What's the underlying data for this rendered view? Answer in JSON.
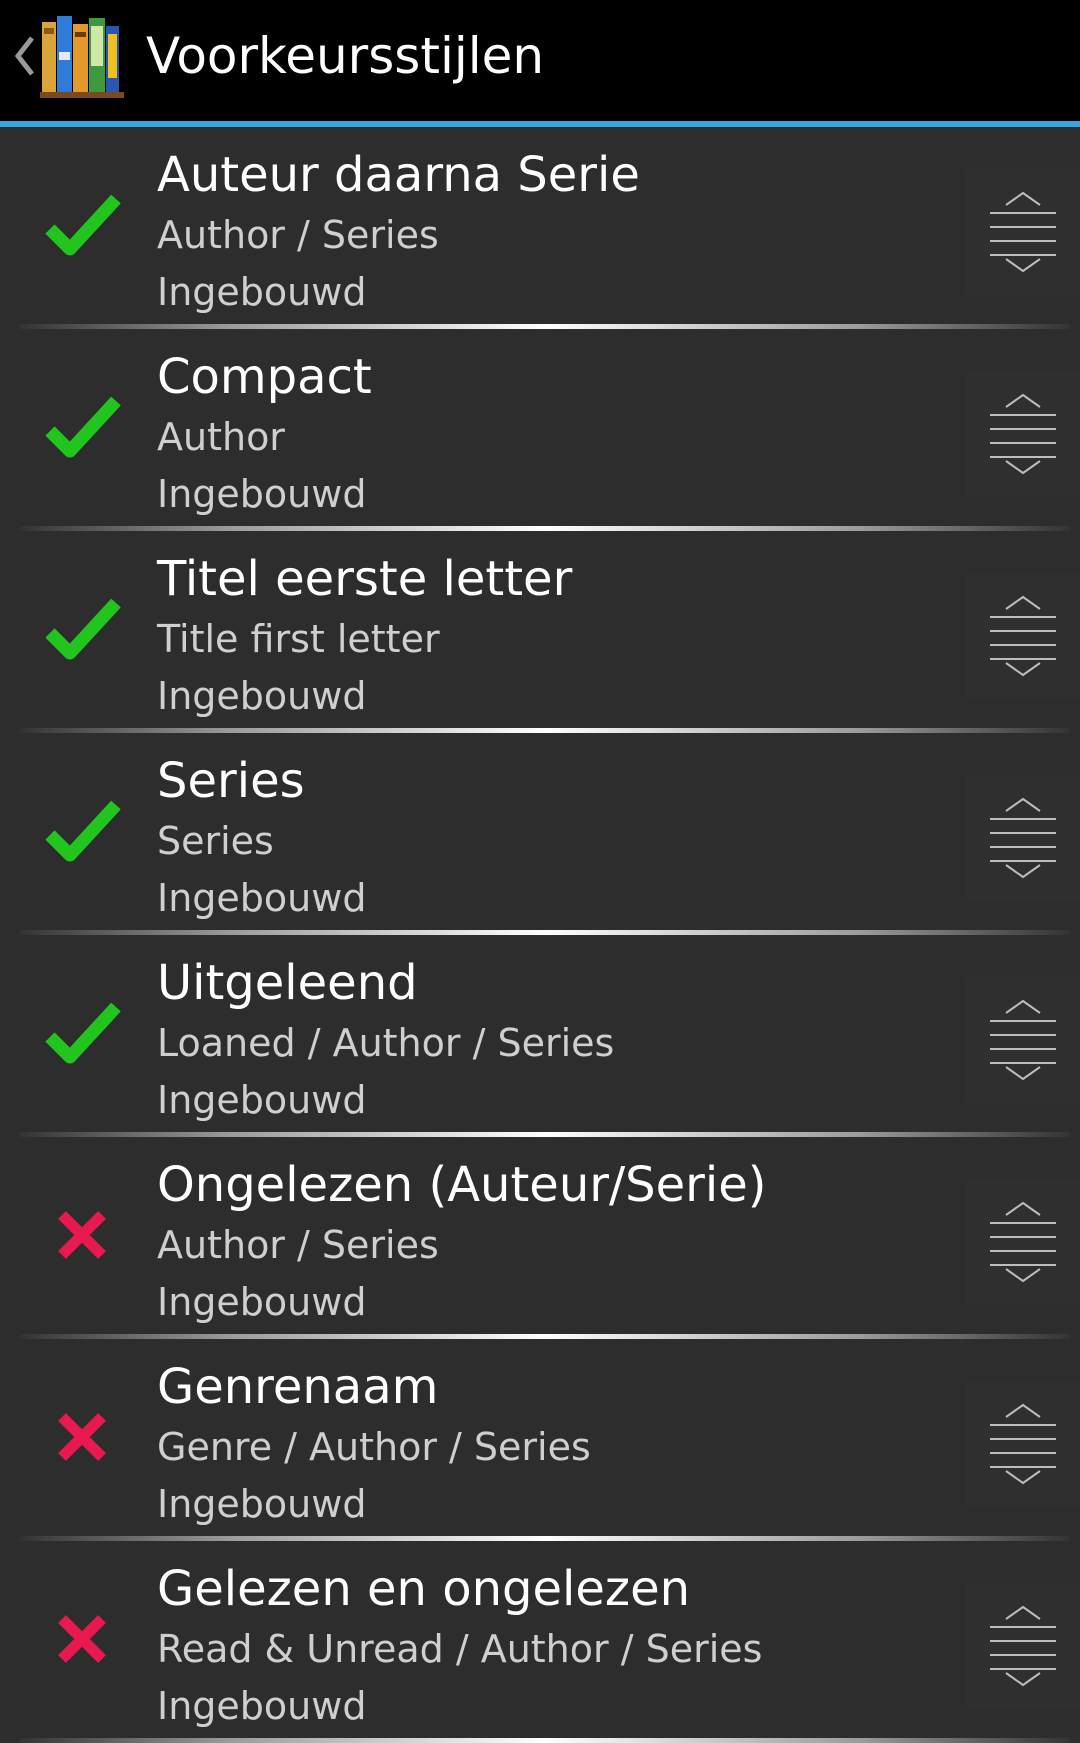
{
  "actionbar": {
    "title": "Voorkeursstijlen",
    "accent_color": "#35a8e0",
    "logo_icon": "bookshelf-icon",
    "up_icon": "chevron-left-icon"
  },
  "styles": [
    {
      "title": "Auteur daarna Serie",
      "groups": "Author / Series",
      "kind": "Ingebouwd",
      "preferred": true
    },
    {
      "title": "Compact",
      "groups": "Author",
      "kind": "Ingebouwd",
      "preferred": true
    },
    {
      "title": "Titel eerste letter",
      "groups": "Title first letter",
      "kind": "Ingebouwd",
      "preferred": true
    },
    {
      "title": "Series",
      "groups": "Series",
      "kind": "Ingebouwd",
      "preferred": true
    },
    {
      "title": "Uitgeleend",
      "groups": "Loaned / Author / Series",
      "kind": "Ingebouwd",
      "preferred": true
    },
    {
      "title": "Ongelezen (Auteur/Serie)",
      "groups": "Author / Series",
      "kind": "Ingebouwd",
      "preferred": false
    },
    {
      "title": "Genrenaam",
      "groups": "Genre / Author / Series",
      "kind": "Ingebouwd",
      "preferred": false
    },
    {
      "title": "Gelezen en ongelezen",
      "groups": "Read & Unread / Author / Series",
      "kind": "Ingebouwd",
      "preferred": false
    }
  ],
  "icons": {
    "preferred": "checkmark-icon",
    "not_preferred": "cross-icon",
    "reorder": "drag-handle-icon"
  },
  "colors": {
    "check": "#22c51e",
    "cross": "#e8194f",
    "background": "#2d2d2d"
  }
}
